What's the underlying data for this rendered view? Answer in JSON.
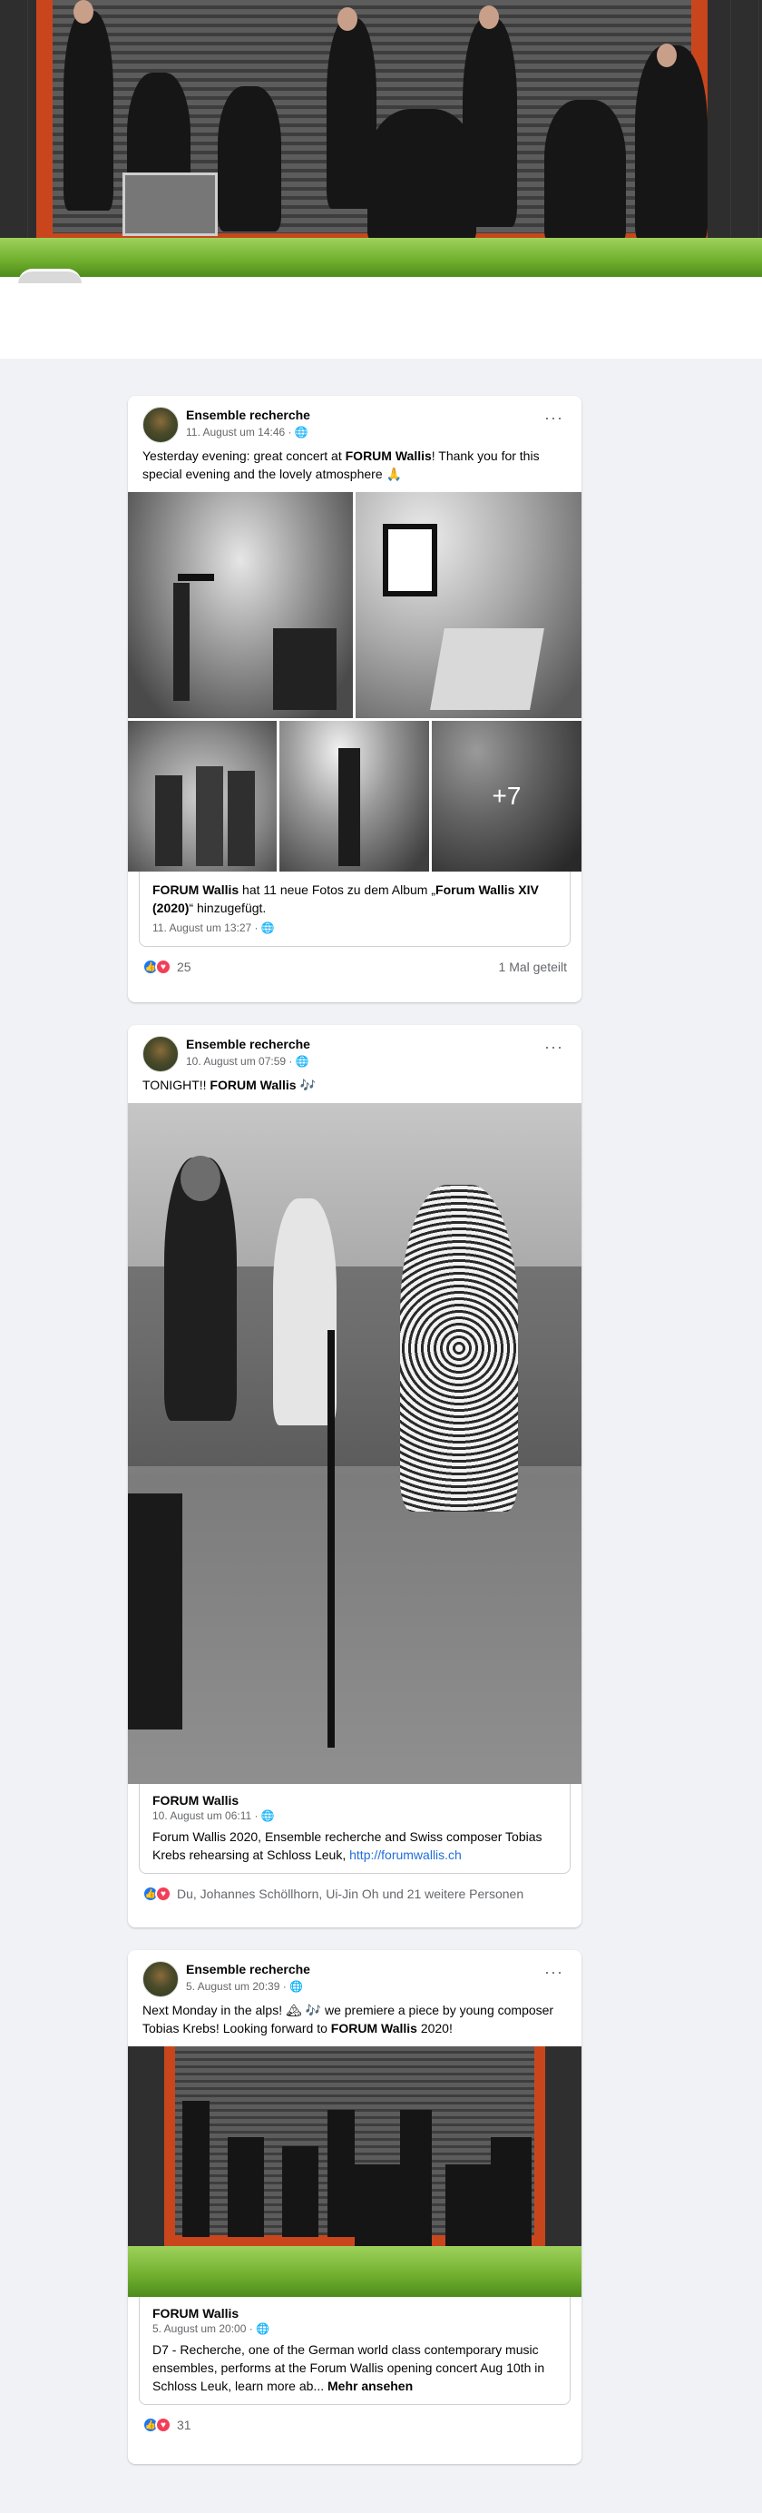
{
  "posts": [
    {
      "page_name": "Ensemble recherche",
      "meta": "11. August um 14:46 · 🌐",
      "more": "···",
      "text_parts": [
        "Yesterday evening: great concert at ",
        "FORUM Wallis",
        "! Thank you for this special evening and the lovely atmosphere 🙏"
      ],
      "photo_more": "+7",
      "share": {
        "line_parts": [
          "FORUM Wallis",
          " hat 11 neue Fotos zu dem Album „",
          "Forum Wallis XIV (2020)",
          "“ hinzugefügt."
        ],
        "time": "11. August um 13:27 · 🌐"
      },
      "reactions_count": "25",
      "shares": "1 Mal geteilt"
    },
    {
      "page_name": "Ensemble recherche",
      "meta": "10. August um 07:59 · 🌐",
      "more": "···",
      "text_parts": [
        "TONIGHT!! ",
        "FORUM Wallis",
        " 🎶"
      ],
      "card": {
        "title": "FORUM Wallis",
        "time": "10. August um 06:11 · 🌐",
        "desc": "Forum Wallis 2020, Ensemble recherche and Swiss composer Tobias Krebs rehearsing at Schloss Leuk, ",
        "link": "http://forumwallis.ch"
      },
      "reactions_text": "Du, Johannes Schöllhorn, Ui-Jin Oh und 21 weitere Personen"
    },
    {
      "page_name": "Ensemble recherche",
      "meta": "5. August um 20:39 · 🌐",
      "more": "···",
      "text_parts": [
        "Next Monday in the alps! 🏔 🎶 we premiere a piece by young composer Tobias Krebs! Looking forward to ",
        "FORUM Wallis",
        " 2020!"
      ],
      "card": {
        "title": "FORUM Wallis",
        "time": "5. August um 20:00 · 🌐",
        "desc": "D7 - Recherche, one of the German world class contemporary music ensembles, performs at the Forum Wallis opening concert Aug 10th in Schloss Leuk, learn more ab... ",
        "more_label": "Mehr ansehen"
      },
      "reactions_count": "31"
    }
  ],
  "icons": {
    "like": "👍",
    "love": "♥"
  }
}
